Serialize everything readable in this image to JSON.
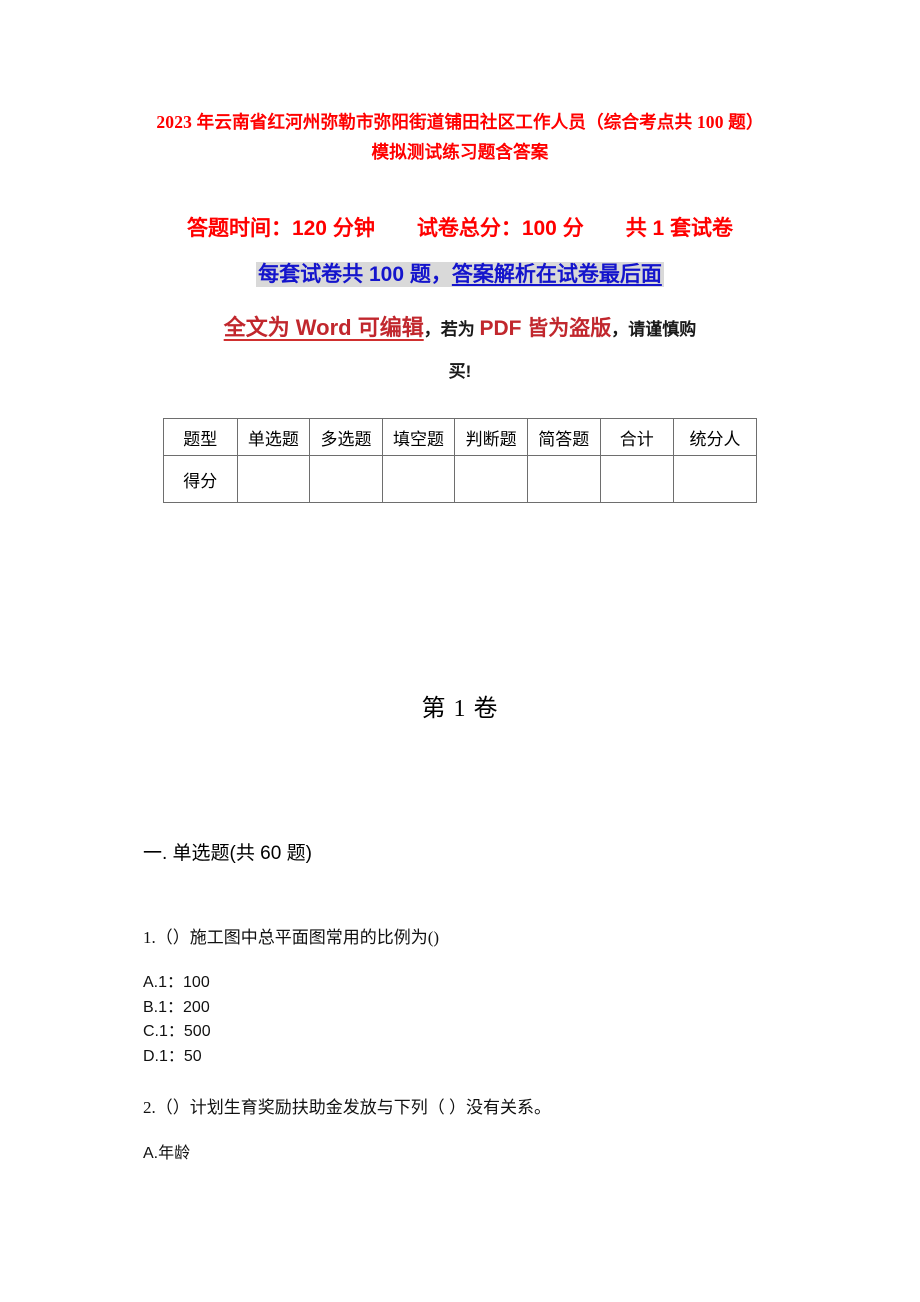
{
  "document": {
    "title": "2023 年云南省红河州弥勒市弥阳街道铺田社区工作人员（综合考点共 100 题）模拟测试练习题含答案",
    "title_color": "#FF0000"
  },
  "info": {
    "exam_time_label": "答题时间：120 分钟",
    "total_score_label": "试卷总分：100 分",
    "paper_count_label": "共 1 套试卷",
    "line1_full": "答题时间：120 分钟　　试卷总分：100 分　　共 1 套试卷",
    "line2_prefix": "每套试卷共 100 题，",
    "line2_underlined": "答案解析在试卷最后面",
    "line2_highlight_color": "#D9D9D9",
    "line2_text_color": "#1414CC",
    "line3_part1": "全文为 Word 可编辑",
    "line3_part2": "，若为 ",
    "line3_part3": "PDF 皆为盗版",
    "line3_part4": "，请谨慎购",
    "line3_part5": "买!",
    "line3_red": "#C1272D"
  },
  "score_table": {
    "headers": [
      "题型",
      "单选题",
      "多选题",
      "填空题",
      "判断题",
      "简答题",
      "合计",
      "统分人"
    ],
    "score_row": [
      "得分",
      "",
      "",
      "",
      "",
      "",
      "",
      ""
    ]
  },
  "volume": {
    "heading": "第 1 卷"
  },
  "section": {
    "heading": "一. 单选题(共 60 题)"
  },
  "questions": [
    {
      "stem": "1.（）施工图中总平面图常用的比例为()",
      "options": [
        "A.1：100",
        "B.1：200",
        "C.1：500",
        "D.1：50"
      ]
    },
    {
      "stem": "2.（）计划生育奖励扶助金发放与下列（ ）没有关系。",
      "options": [
        "A.年龄"
      ]
    }
  ]
}
